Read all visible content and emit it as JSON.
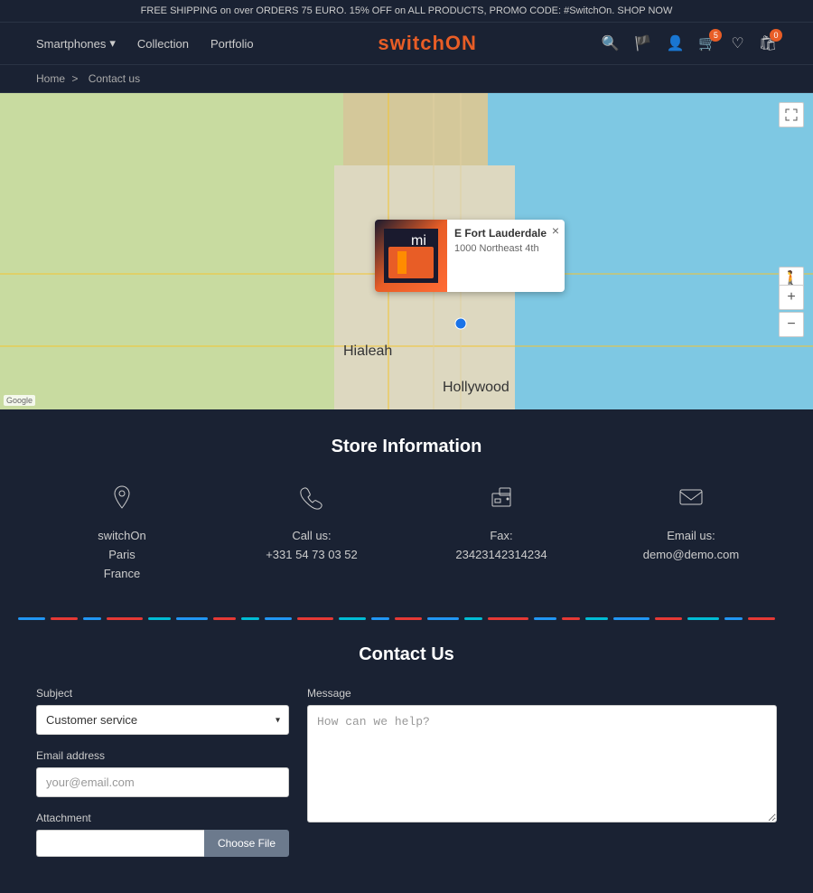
{
  "banner": {
    "text": "FREE SHIPPING on over ORDERS 75 EURO. 15% OFF on ALL PRODUCTS, PROMO CODE: #SwitchOn. SHOP NOW"
  },
  "header": {
    "nav": {
      "smartphones": "Smartphones",
      "collection": "Collection",
      "portfolio": "Portfolio"
    },
    "logo": {
      "prefix": "switch",
      "suffix": "ON"
    },
    "icons": {
      "search": "🔍",
      "flag": "🏴",
      "user": "👤",
      "cart_badge": "5",
      "wishlist_badge": "",
      "bag_badge": "0"
    }
  },
  "breadcrumb": {
    "home": "Home",
    "separator": ">",
    "current": "Contact us"
  },
  "map": {
    "popup": {
      "title": "E Fort Lauderdale",
      "address": "1000 Northeast 4th",
      "close": "×"
    },
    "zoom_in": "+",
    "zoom_out": "−",
    "watermark": "Google"
  },
  "store_info": {
    "title": "Store Information",
    "items": [
      {
        "icon": "📍",
        "lines": [
          "switchOn",
          "Paris",
          "France"
        ],
        "label": ""
      },
      {
        "icon": "📞",
        "label": "Call us:",
        "value": "+331 54 73 03 52"
      },
      {
        "icon": "🖨",
        "label": "Fax:",
        "value": "23423142314234"
      },
      {
        "icon": "✉",
        "label": "Email us:",
        "value": "demo@demo.com"
      }
    ]
  },
  "contact": {
    "title": "Contact Us",
    "form": {
      "subject_label": "Subject",
      "subject_default": "Customer service",
      "email_label": "Email address",
      "email_placeholder": "your@email.com",
      "attachment_label": "Attachment",
      "file_button": "Choose File",
      "message_label": "Message",
      "message_placeholder": "How can we help?"
    }
  }
}
